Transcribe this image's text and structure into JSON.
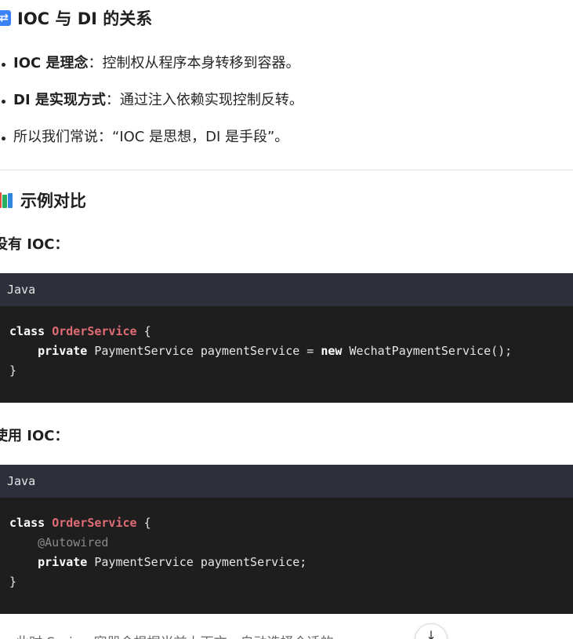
{
  "section_relation": {
    "icon": "sync-arrows-icon",
    "title": "IOC 与 DI 的关系",
    "items": [
      {
        "bold": "IOC 是理念",
        "text": "：控制权从程序本身转移到容器。"
      },
      {
        "bold": "DI 是实现方式",
        "text": "：通过注入依赖实现控制反转。"
      },
      {
        "bold": "",
        "text": "所以我们常说：“IOC 是思想，DI 是手段”。"
      }
    ]
  },
  "section_example": {
    "icon": "books-icon",
    "title": "示例对比",
    "without_label": "没有 IOC：",
    "with_label": "使用 IOC："
  },
  "code_without": {
    "lang": "Java",
    "l1_kw": "class",
    "l1_cls": "OrderService",
    "l1_rest": " {",
    "l2_indent": "    ",
    "l2_kw": "private",
    "l2_mid": " PaymentService paymentService = ",
    "l2_kw2": "new",
    "l2_rest": " WechatPaymentService();",
    "l3": "}"
  },
  "code_with": {
    "lang": "Java",
    "l1_kw": "class",
    "l1_cls": "OrderService",
    "l1_rest": " {",
    "l2_indent": "    ",
    "l2_ann": "@Autowired",
    "l3_indent": "    ",
    "l3_kw": "private",
    "l3_rest": " PaymentService paymentService;",
    "l4": "}"
  },
  "tail": {
    "text": "此时 Spring 容器会根据当前上下文，自动选择合适的"
  },
  "scroll_button": {
    "icon": "arrow-down-icon",
    "glyph": "↓"
  },
  "colors": {
    "code_bg": "#1e1e1e",
    "code_header_bg": "#2d2f3a",
    "class_name": "#e06c75",
    "annotation": "#8a8a8a"
  }
}
